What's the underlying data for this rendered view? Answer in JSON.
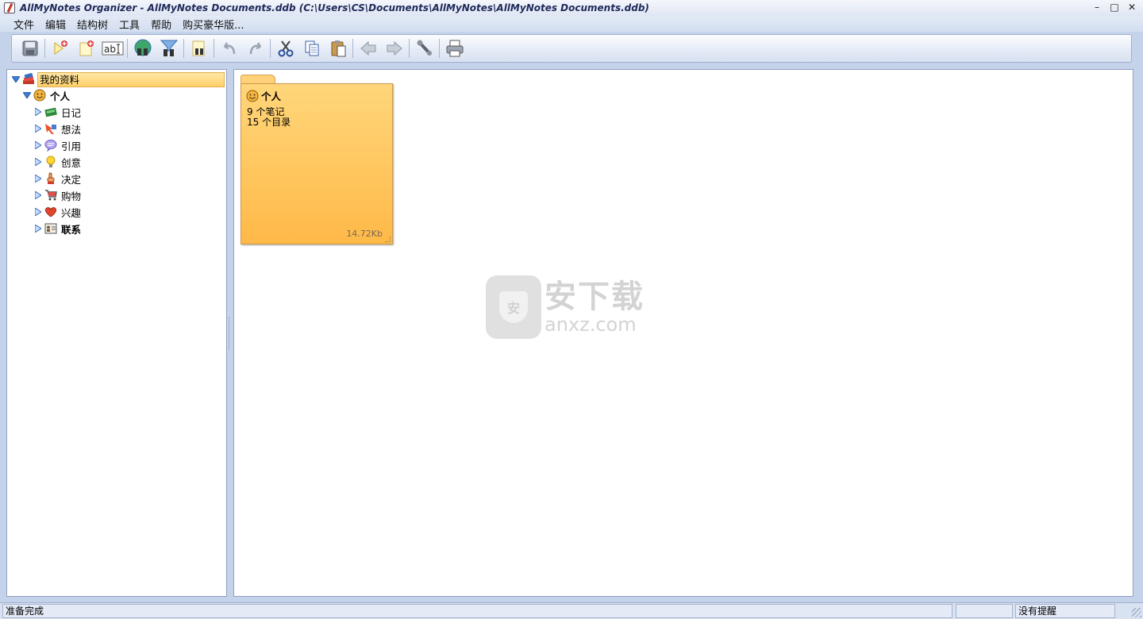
{
  "window": {
    "title": "AllMyNotes Organizer - AllMyNotes Documents.ddb (C:\\Users\\CS\\Documents\\AllMyNotes\\AllMyNotes Documents.ddb)",
    "controls": {
      "minimize": "–",
      "maximize": "□",
      "close": "✕"
    }
  },
  "menu": {
    "items": [
      "文件",
      "编辑",
      "结构树",
      "工具",
      "帮助",
      "购买豪华版..."
    ]
  },
  "toolbar": {
    "buttons": [
      "save-icon",
      "new-note-icon",
      "new-folder-icon",
      "rename-icon",
      "search-web-icon",
      "search-filter-icon",
      "find-icon",
      "undo-icon",
      "redo-icon",
      "cut-icon",
      "copy-icon",
      "paste-icon",
      "back-arrow-icon",
      "forward-arrow-icon",
      "settings-wrench-icon",
      "print-icon"
    ]
  },
  "tree": {
    "root": {
      "label": "我的资料",
      "icon": "book-stack-icon"
    },
    "personal": {
      "label": "个人",
      "icon": "smiley-icon"
    },
    "items": [
      {
        "label": "日记",
        "icon": "diary-book-icon"
      },
      {
        "label": "想法",
        "icon": "ideas-arrow-icon"
      },
      {
        "label": "引用",
        "icon": "quote-bubble-icon"
      },
      {
        "label": "创意",
        "icon": "lightbulb-icon"
      },
      {
        "label": "决定",
        "icon": "pointing-hand-icon"
      },
      {
        "label": "购物",
        "icon": "shopping-cart-icon"
      },
      {
        "label": "兴趣",
        "icon": "heart-icon"
      },
      {
        "label": "联系",
        "icon": "contact-card-icon"
      }
    ]
  },
  "content": {
    "folder_card": {
      "title": "个人",
      "notes_count": "9 个笔记",
      "folders_count": "15 个目录",
      "size": "14.72Kb"
    }
  },
  "watermark": {
    "cn": "安下载",
    "en": "anxz.com",
    "badge": "安"
  },
  "status": {
    "left": "准备完成",
    "middle": "",
    "right": "没有提醒"
  },
  "colors": {
    "accent": "#ffc65a",
    "frame": "#c5d3ea",
    "border": "#8ea0c4"
  }
}
